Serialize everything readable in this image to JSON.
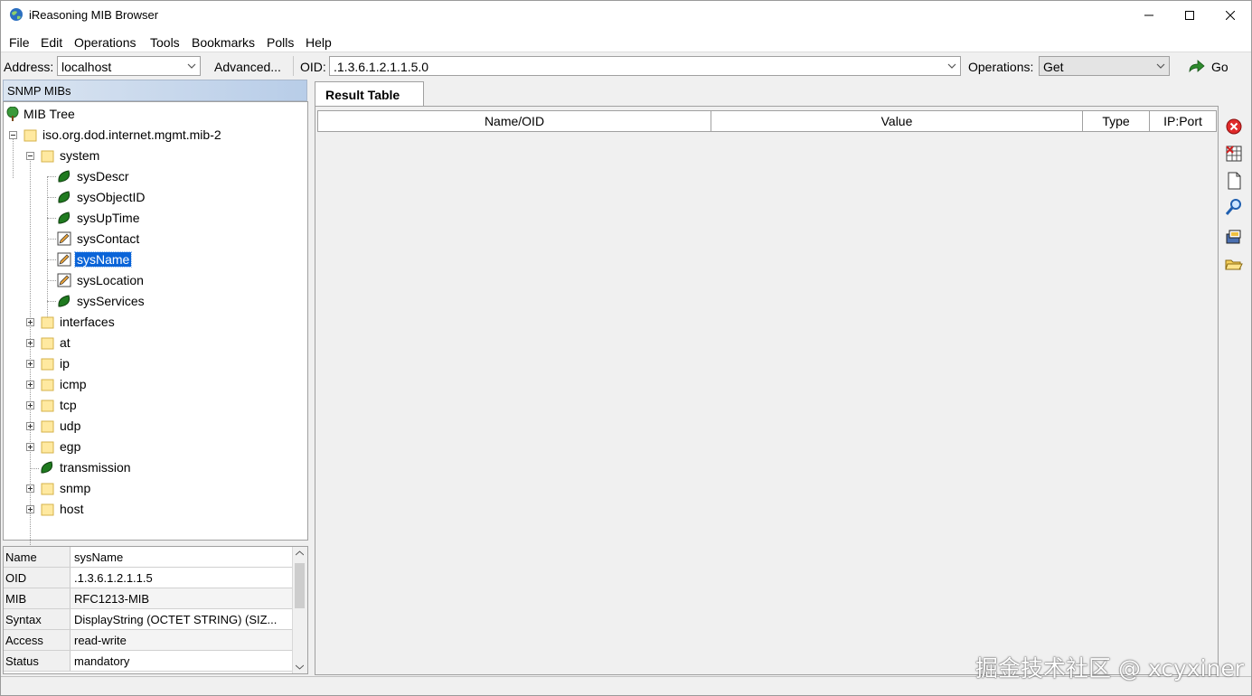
{
  "window": {
    "title": "iReasoning MIB Browser"
  },
  "menu": [
    "File",
    "Edit",
    "Operations",
    "Tools",
    "Bookmarks",
    "Polls",
    "Help"
  ],
  "toolbar": {
    "address_label": "Address:",
    "address_value": "localhost",
    "advanced_label": "Advanced...",
    "oid_label": "OID:",
    "oid_value": ".1.3.6.1.2.1.1.5.0",
    "operations_label": "Operations:",
    "operations_value": "Get",
    "go_label": "Go"
  },
  "left_panel": {
    "title": "SNMP MIBs"
  },
  "tree": {
    "root": "MIB Tree",
    "mib2": "iso.org.dod.internet.mgmt.mib-2",
    "system": "system",
    "system_children": [
      "sysDescr",
      "sysObjectID",
      "sysUpTime",
      "sysContact",
      "sysName",
      "sysLocation",
      "sysServices"
    ],
    "groups": [
      "interfaces",
      "at",
      "ip",
      "icmp",
      "tcp",
      "udp",
      "egp",
      "transmission",
      "snmp",
      "host"
    ],
    "selected": "sysName"
  },
  "properties": [
    {
      "key": "Name",
      "value": "sysName"
    },
    {
      "key": "OID",
      "value": ".1.3.6.1.2.1.1.5"
    },
    {
      "key": "MIB",
      "value": "RFC1213-MIB"
    },
    {
      "key": "Syntax",
      "value": "DisplayString (OCTET STRING) (SIZ..."
    },
    {
      "key": "Access",
      "value": "read-write"
    },
    {
      "key": "Status",
      "value": "mandatory"
    }
  ],
  "result": {
    "tab_label": "Result Table",
    "columns": [
      "Name/OID",
      "Value",
      "Type",
      "IP:Port"
    ]
  },
  "side_tools": [
    "delete-icon",
    "clear-table-icon",
    "document-icon",
    "find-icon",
    "export-icon",
    "open-folder-icon"
  ],
  "watermark": "掘金技术社区 @ xcyxiner"
}
